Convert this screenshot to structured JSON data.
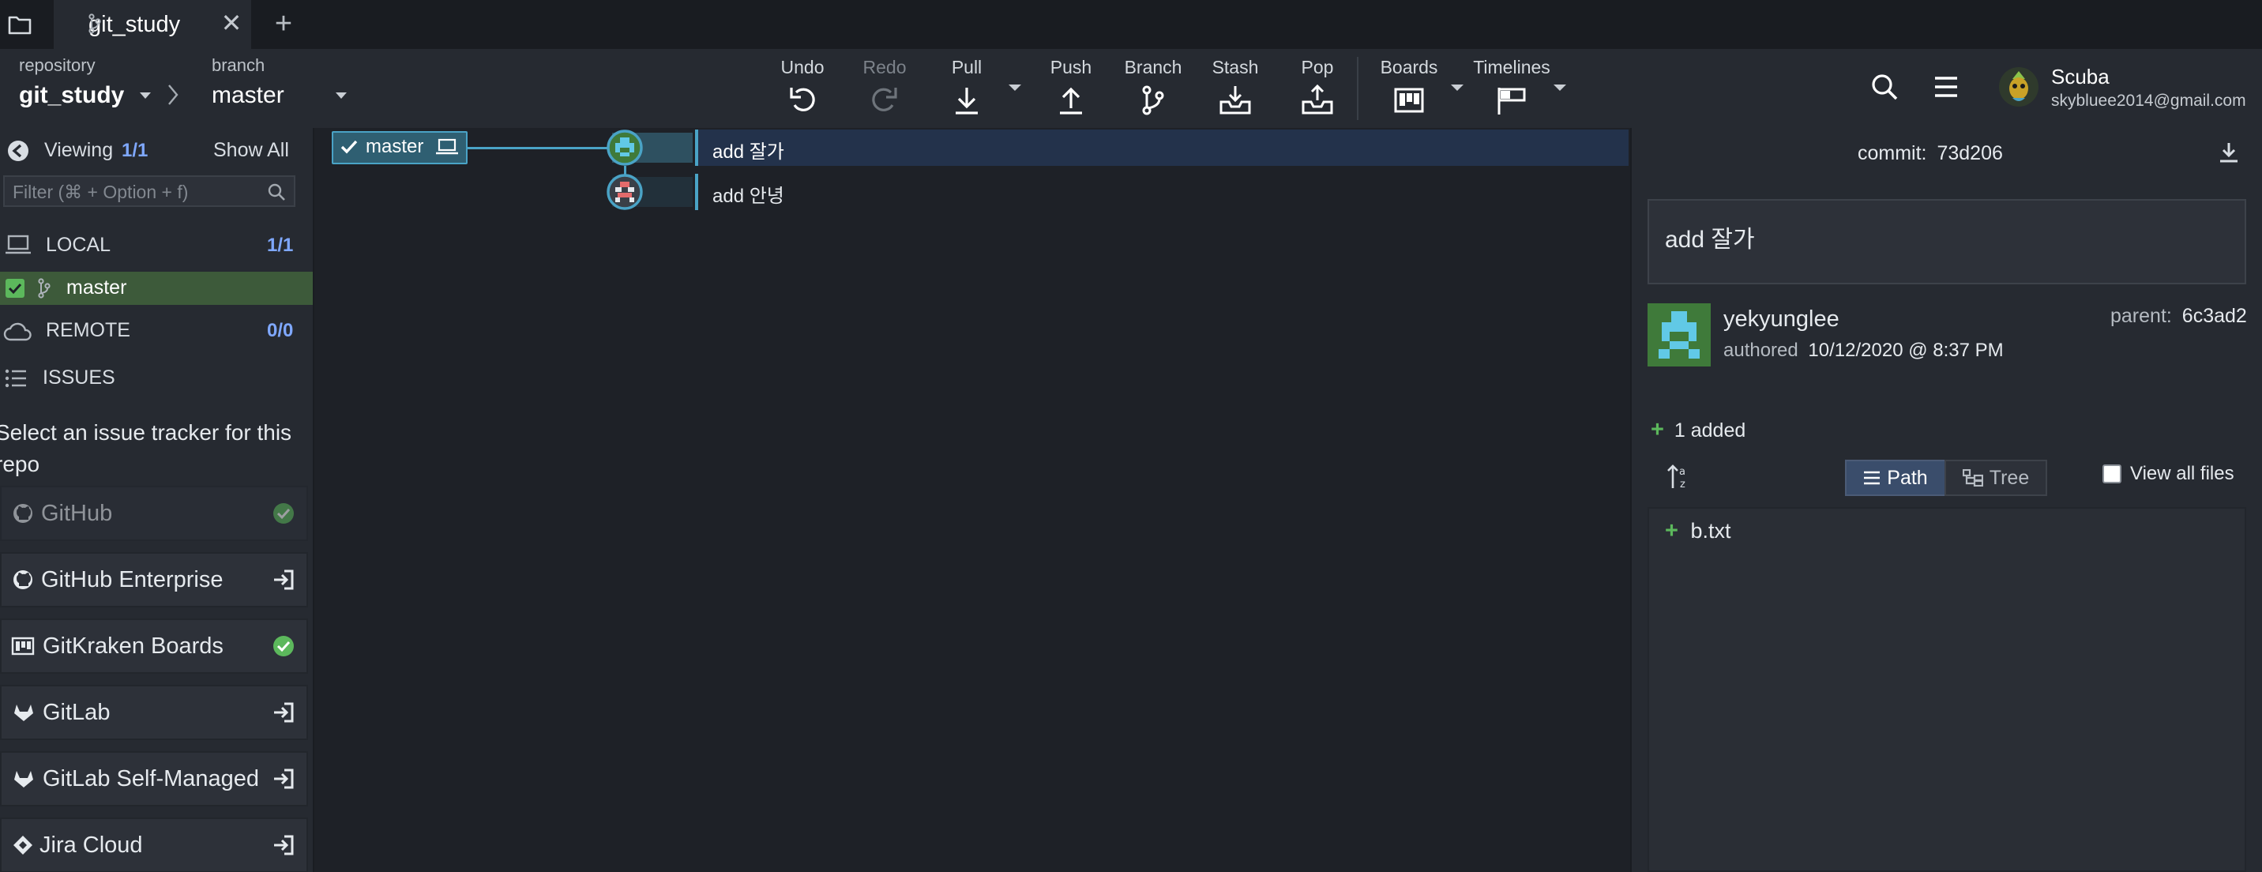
{
  "titlebar": {
    "tab_title": "git_study",
    "close_glyph": "✕",
    "add_glyph": "+"
  },
  "toolbar": {
    "repo_caption": "repository",
    "repo_name": "git_study",
    "branch_caption": "branch",
    "branch_name": "master",
    "actions": {
      "undo": "Undo",
      "redo": "Redo",
      "pull": "Pull",
      "push": "Push",
      "branch": "Branch",
      "stash": "Stash",
      "pop": "Pop",
      "boards": "Boards",
      "timelines": "Timelines"
    },
    "user": {
      "name": "Scuba",
      "email": "skybluee2014@gmail.com"
    }
  },
  "sidebar": {
    "viewing_label": "Viewing",
    "viewing_count": "1/1",
    "show_all": "Show All",
    "filter_placeholder": "Filter (⌘ + Option + f)",
    "local_label": "LOCAL",
    "local_count": "1/1",
    "local_branch": "master",
    "remote_label": "REMOTE",
    "remote_count": "0/0",
    "issues_label": "ISSUES",
    "issues_prompt": "Select an issue tracker for this repo",
    "trackers": [
      {
        "label": "GitHub",
        "status": "connected"
      },
      {
        "label": "GitHub Enterprise",
        "status": "login"
      },
      {
        "label": "GitKraken Boards",
        "status": "connected"
      },
      {
        "label": "GitLab",
        "status": "login"
      },
      {
        "label": "GitLab Self-Managed",
        "status": "login"
      },
      {
        "label": "Jira Cloud",
        "status": "login"
      }
    ]
  },
  "graph": {
    "branch_tag": "master",
    "commits": [
      {
        "message": "add 잘가"
      },
      {
        "message": "add 안녕"
      }
    ]
  },
  "commit_panel": {
    "commit_label": "commit:",
    "commit_sha": "73d206",
    "summary": "add 잘가",
    "author": "yekyunglee",
    "authored_label": "authored",
    "authored_date": "10/12/2020 @ 8:37 PM",
    "parent_label": "parent:",
    "parent_sha": "6c3ad2",
    "added_summary": "1 added",
    "view_path": "Path",
    "view_tree": "Tree",
    "view_all_files": "View all files",
    "files": [
      {
        "name": "b.txt",
        "change": "added"
      }
    ]
  },
  "colors": {
    "accent": "#4aa3c6",
    "added_green": "#5cb85c",
    "selected_row": "#23324b"
  }
}
